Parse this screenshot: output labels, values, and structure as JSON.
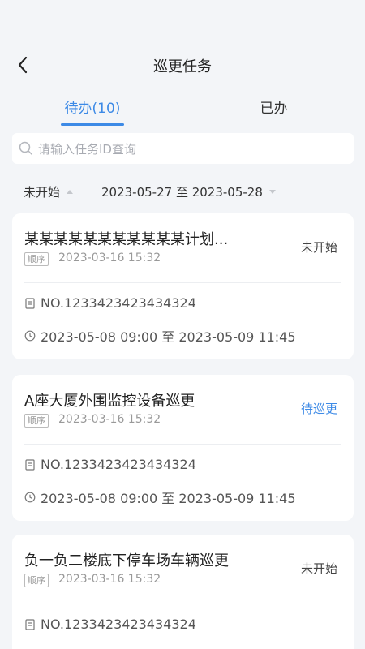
{
  "header": {
    "title": "巡更任务",
    "back_icon": "back-arrow-icon"
  },
  "tabs": [
    {
      "label": "待办(10)",
      "active": true
    },
    {
      "label": "已办",
      "active": false
    }
  ],
  "search": {
    "placeholder": "请输入任务ID查询"
  },
  "filters": {
    "status": "未开始",
    "date_range": "2023-05-27 至 2023-05-28"
  },
  "tasks": [
    {
      "title": "某某某某某某某某某某某计划...",
      "badge": "顺序",
      "date": "2023-03-16 15:32",
      "status": "未开始",
      "number": "NO.1233423423434324",
      "time_range": "2023-05-08 09:00 至 2023-05-09 11:45"
    },
    {
      "title": "A座大厦外围监控设备巡更",
      "badge": "顺序",
      "date": "2023-03-16 15:32",
      "status": "待巡更",
      "number": "NO.1233423423434324",
      "time_range": "2023-05-08 09:00 至 2023-05-09 11:45"
    },
    {
      "title": "负一负二楼底下停车场车辆巡更",
      "badge": "顺序",
      "date": "2023-03-16 15:32",
      "status": "未开始",
      "number": "NO.1233423423434324"
    }
  ],
  "colors": {
    "accent": "#3d8ae6",
    "background": "#f3f5f8"
  }
}
